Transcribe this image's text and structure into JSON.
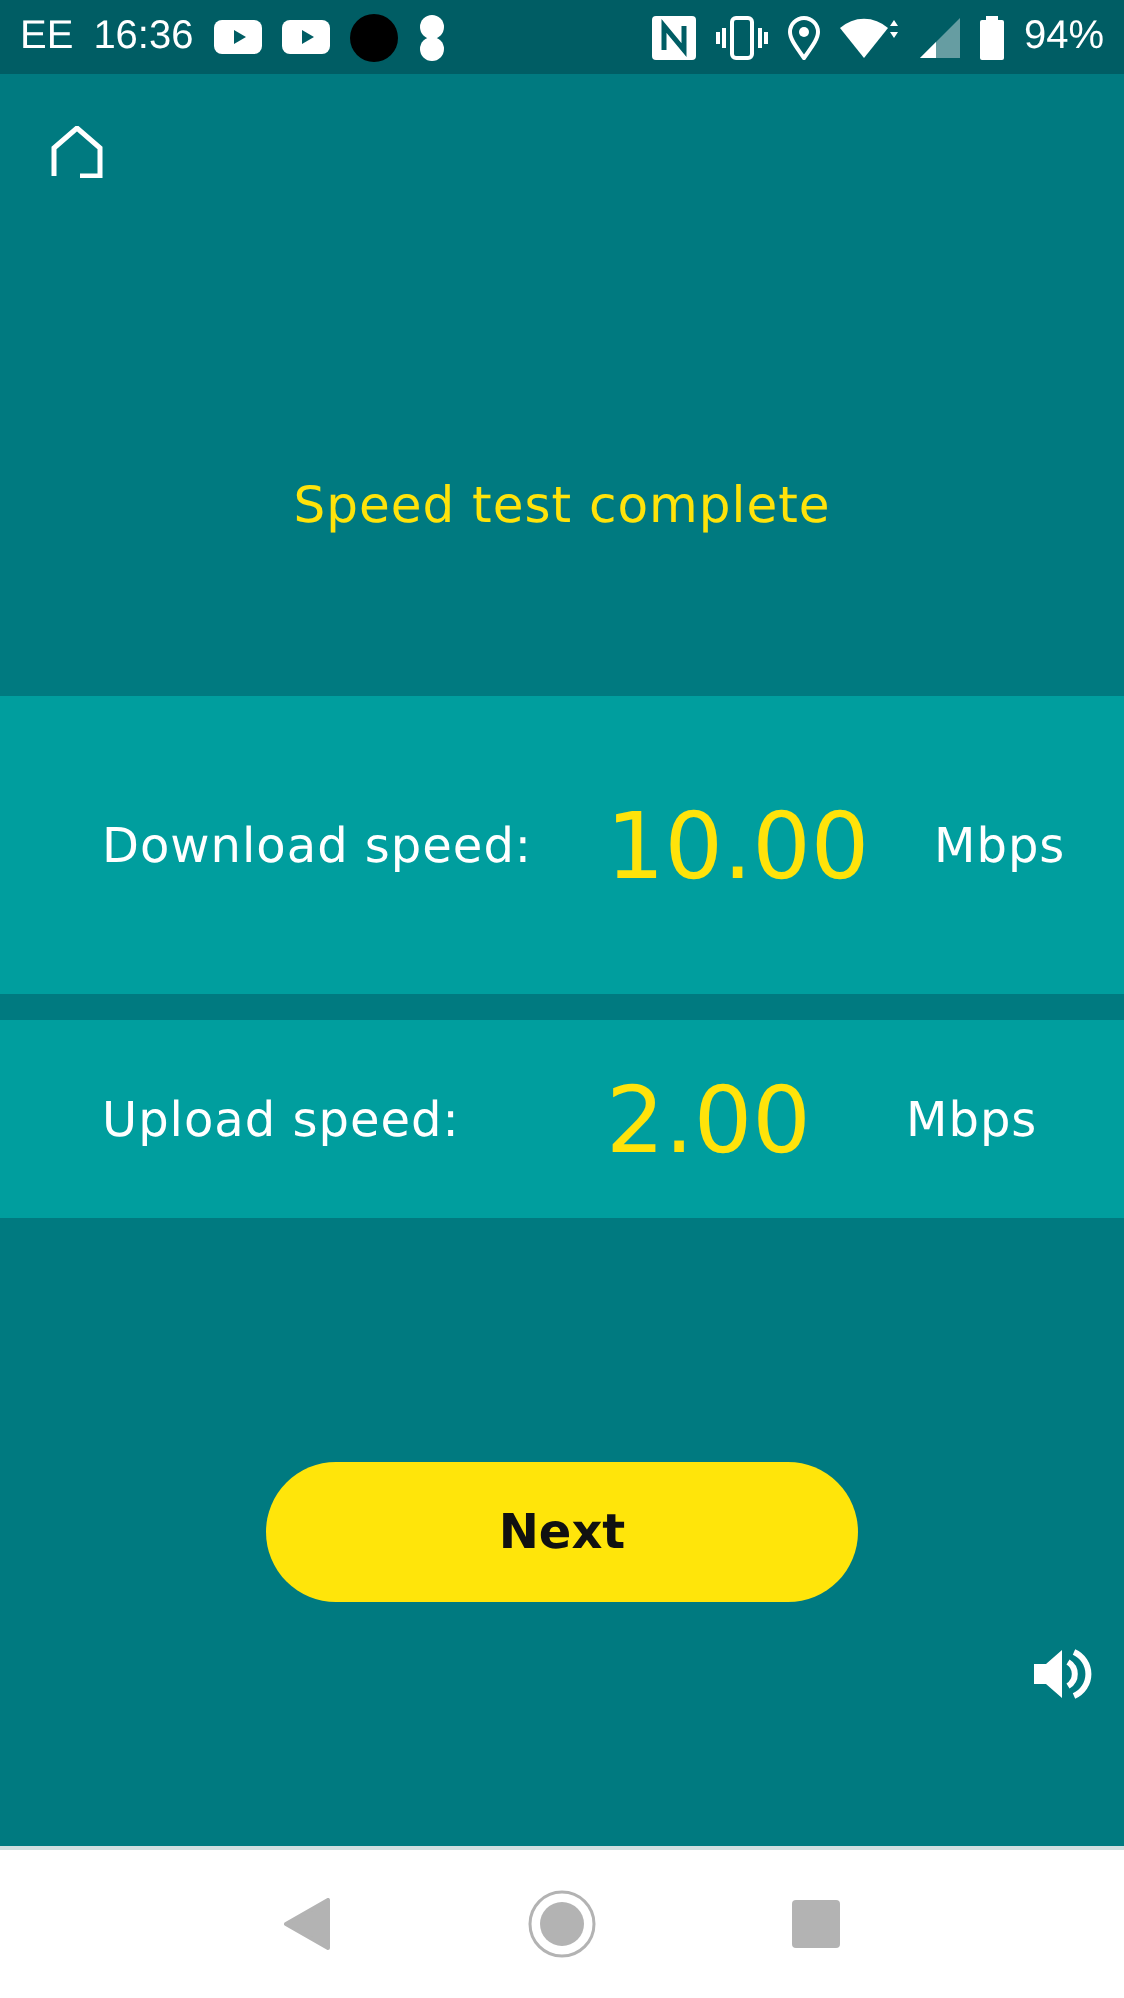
{
  "status_bar": {
    "carrier": "EE",
    "time": "16:36",
    "battery": "94%"
  },
  "title": "Speed test complete",
  "results": [
    {
      "label": "Download speed:",
      "value": "10.00",
      "unit": "Mbps"
    },
    {
      "label": "Upload speed:",
      "value": "2.00",
      "unit": "Mbps"
    }
  ],
  "next_button": "Next"
}
